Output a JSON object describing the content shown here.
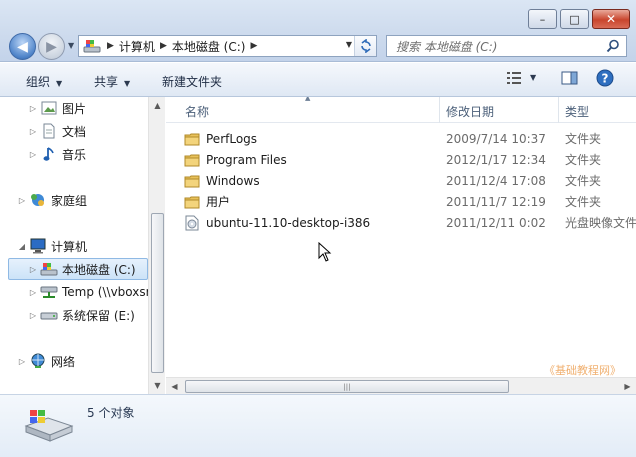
{
  "window": {
    "minimize": "–",
    "maximize": "□",
    "close": "✕"
  },
  "address": {
    "crumbs": [
      "计算机",
      "本地磁盘 (C:)"
    ]
  },
  "search": {
    "placeholder": "搜索 本地磁盘 (C:)"
  },
  "toolbar": {
    "organize": "组织",
    "share": "共享",
    "new_folder": "新建文件夹"
  },
  "nav": {
    "items": [
      {
        "label": "图片",
        "icon": "pictures-icon"
      },
      {
        "label": "文档",
        "icon": "documents-icon"
      },
      {
        "label": "音乐",
        "icon": "music-icon"
      },
      {
        "label": "家庭组",
        "icon": "homegroup-icon"
      },
      {
        "label": "计算机",
        "icon": "computer-icon"
      },
      {
        "label": "本地磁盘 (C:)",
        "icon": "local-disk-icon",
        "selected": true
      },
      {
        "label": "Temp (\\\\vboxsr",
        "icon": "network-drive-icon"
      },
      {
        "label": "系统保留 (E:)",
        "icon": "drive-icon"
      },
      {
        "label": "网络",
        "icon": "network-icon"
      }
    ]
  },
  "columns": {
    "name": "名称",
    "date": "修改日期",
    "type": "类型"
  },
  "files": [
    {
      "name": "PerfLogs",
      "date": "2009/7/14 10:37",
      "type": "文件夹",
      "icon": "folder-icon"
    },
    {
      "name": "Program Files",
      "date": "2012/1/17 12:34",
      "type": "文件夹",
      "icon": "folder-icon"
    },
    {
      "name": "Windows",
      "date": "2011/12/4 17:08",
      "type": "文件夹",
      "icon": "folder-icon"
    },
    {
      "name": "用户",
      "date": "2011/11/7 12:19",
      "type": "文件夹",
      "icon": "folder-icon"
    },
    {
      "name": "ubuntu-11.10-desktop-i386",
      "date": "2011/12/11 0:02",
      "type": "光盘映像文件",
      "icon": "disc-image-icon"
    }
  ],
  "watermark": "《基础教程网》",
  "status": {
    "count": "5 个对象"
  },
  "colors": {
    "accent": "#3f6aa8",
    "selection": "#cce3f8",
    "folder": "#e9c15a"
  }
}
